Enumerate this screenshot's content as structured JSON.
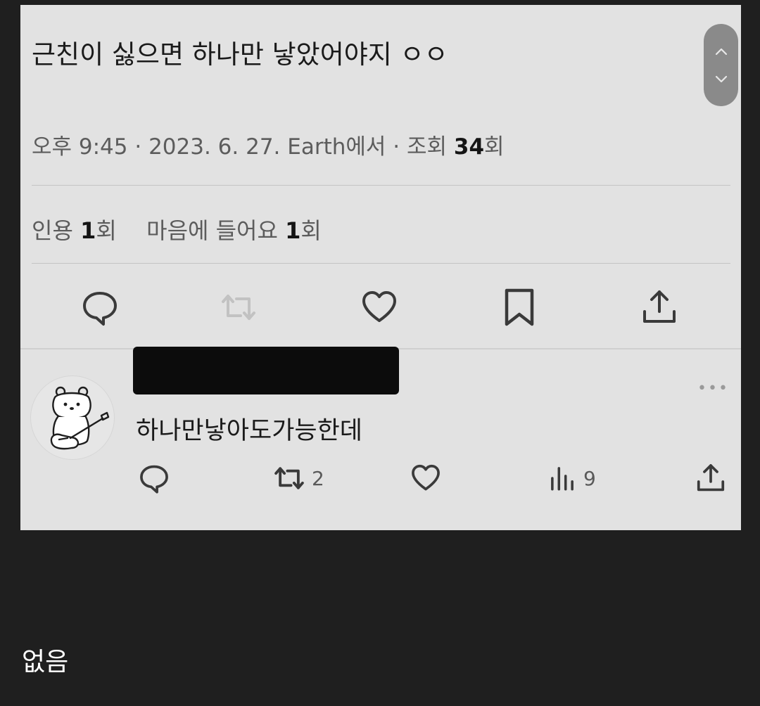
{
  "tweet": {
    "text": "근친이 싫으면 하나만 낳았어야지 ㅇㅇ",
    "meta_prefix": "오후 9:45 · 2023. 6. 27. Earth에서 · 조회 ",
    "views": "34",
    "views_suffix": "회",
    "quote_label": "인용 ",
    "quote_count": "1",
    "quote_suffix": "회",
    "like_label": "마음에 들어요 ",
    "like_count": "1",
    "like_suffix": "회"
  },
  "actions": {
    "reply_icon": "reply-icon",
    "retweet_icon": "retweet-icon",
    "like_icon": "heart-icon",
    "bookmark_icon": "bookmark-icon",
    "share_icon": "share-icon"
  },
  "reply": {
    "text": "하나만낳아도가능한데",
    "more": "•••",
    "retweet_count": "2",
    "view_count": "9"
  },
  "footer": {
    "text": "없음"
  },
  "colors": {
    "background": "#1f1f1f",
    "card": "#e2e2e2",
    "icon": "#4a4a4a",
    "icon_faded": "#b8b8b8"
  }
}
